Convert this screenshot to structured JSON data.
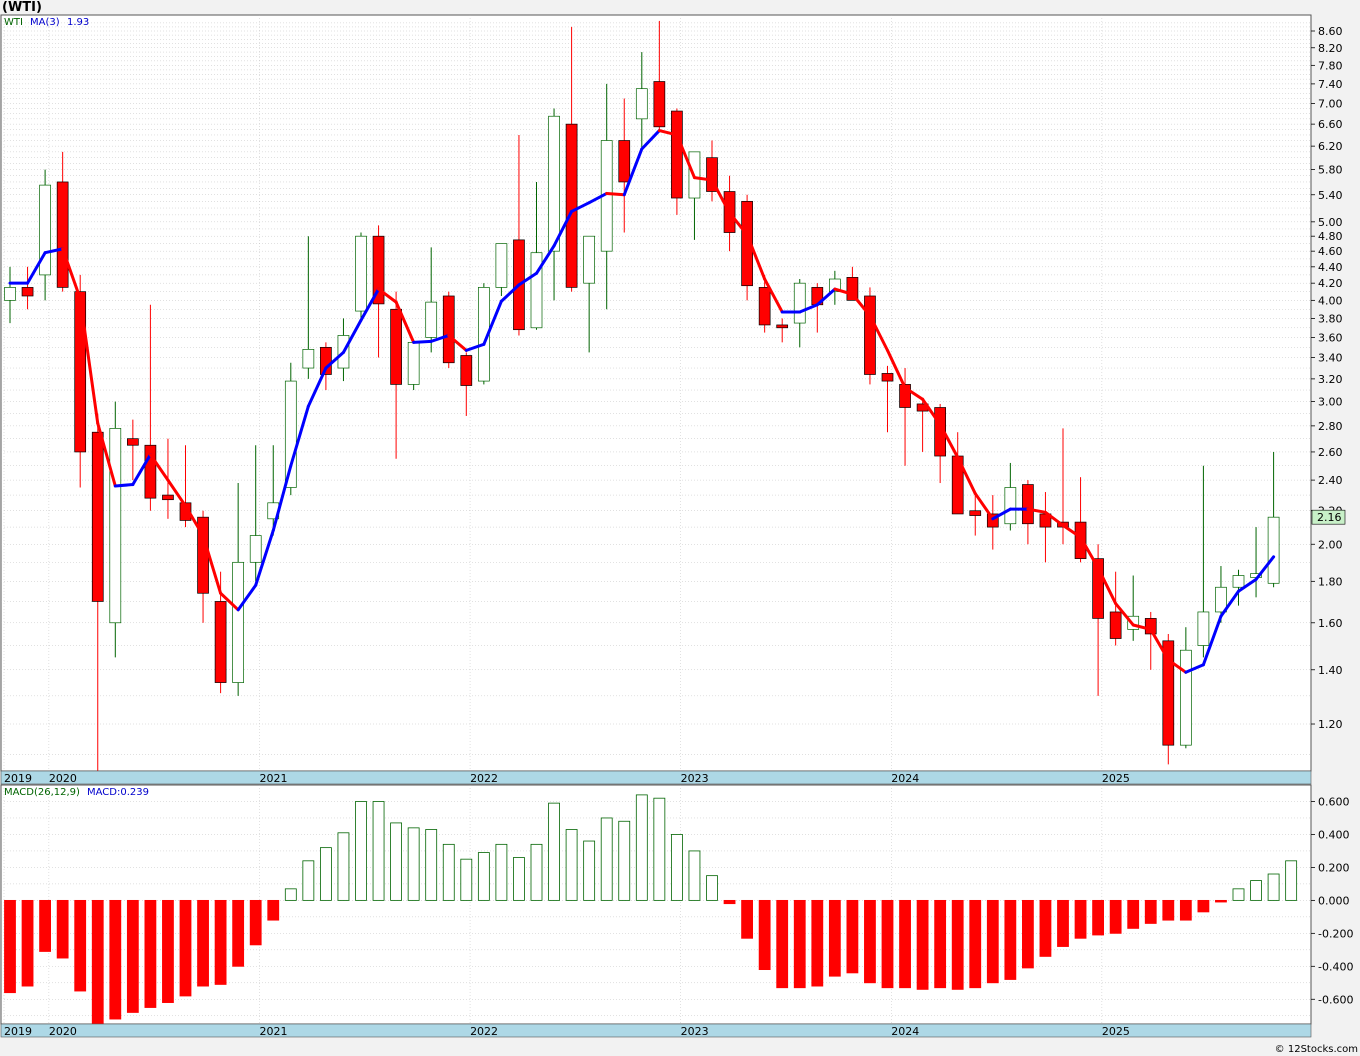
{
  "header": {
    "title": "(WTI)"
  },
  "legend": {
    "price_symbol": "WTI",
    "ma_label": "MA(3)",
    "ma_value": "1.93",
    "macd_label": "MACD(26,12,9)",
    "macd_value": "MACD:0.239"
  },
  "last_price_tag": "2.16",
  "footer": {
    "credit": "© 12Stocks.com"
  },
  "colors": {
    "up": "#006400",
    "down": "#ff0000",
    "ma_up": "#0000ff",
    "ma_down": "#ff0000",
    "axis_band": "#add8e6",
    "grid": "#b4b4b4",
    "tag_bg": "#c8f0c8"
  },
  "chart_data": [
    {
      "type": "candlestick",
      "frequency": "monthly",
      "title": "(WTI)",
      "series_label": "WTI",
      "scale": "log",
      "ylim": [
        1.05,
        9.0
      ],
      "y_ticks": [
        1.2,
        1.4,
        1.6,
        1.8,
        2.0,
        2.2,
        2.4,
        2.6,
        2.8,
        3.0,
        3.2,
        3.4,
        3.6,
        3.8,
        4.0,
        4.2,
        4.4,
        4.6,
        4.8,
        5.0,
        5.4,
        5.8,
        6.2,
        6.6,
        7.0,
        7.4,
        7.8,
        8.2,
        8.6
      ],
      "x_labels": [
        "2019",
        "2020",
        "2021",
        "2022",
        "2023",
        "2024",
        "2025"
      ],
      "year_starts": [
        [
          "2019",
          0
        ],
        [
          "2020",
          3
        ],
        [
          "2021",
          15
        ],
        [
          "2022",
          27
        ],
        [
          "2023",
          39
        ],
        [
          "2024",
          51
        ],
        [
          "2025",
          63
        ]
      ],
      "last_price": 2.16,
      "candles": [
        [
          4.0,
          4.4,
          3.75,
          4.15
        ],
        [
          4.15,
          4.4,
          3.9,
          4.05
        ],
        [
          4.3,
          5.8,
          4.0,
          5.55
        ],
        [
          5.6,
          6.1,
          4.1,
          4.15
        ],
        [
          4.1,
          4.3,
          2.35,
          2.6
        ],
        [
          2.75,
          2.9,
          1.05,
          1.7
        ],
        [
          1.6,
          3.0,
          1.45,
          2.78
        ],
        [
          2.7,
          2.85,
          2.4,
          2.65
        ],
        [
          2.65,
          3.95,
          2.2,
          2.28
        ],
        [
          2.3,
          2.7,
          2.15,
          2.27
        ],
        [
          2.25,
          2.65,
          2.1,
          2.14
        ],
        [
          2.16,
          2.2,
          1.6,
          1.74
        ],
        [
          1.7,
          1.85,
          1.31,
          1.35
        ],
        [
          1.35,
          2.38,
          1.3,
          1.9
        ],
        [
          1.9,
          2.65,
          1.8,
          2.05
        ],
        [
          2.15,
          2.65,
          2.05,
          2.25
        ],
        [
          2.35,
          3.35,
          2.3,
          3.18
        ],
        [
          3.3,
          4.8,
          3.2,
          3.48
        ],
        [
          3.5,
          3.55,
          3.1,
          3.24
        ],
        [
          3.3,
          3.8,
          3.18,
          3.62
        ],
        [
          3.88,
          4.85,
          3.8,
          4.8
        ],
        [
          4.8,
          4.95,
          3.4,
          3.96
        ],
        [
          3.9,
          4.1,
          2.55,
          3.15
        ],
        [
          3.15,
          3.55,
          3.1,
          3.55
        ],
        [
          3.6,
          4.65,
          3.45,
          3.98
        ],
        [
          4.05,
          4.1,
          3.3,
          3.35
        ],
        [
          3.42,
          3.45,
          2.88,
          3.14
        ],
        [
          3.18,
          4.2,
          3.15,
          4.15
        ],
        [
          4.15,
          4.7,
          4.05,
          4.7
        ],
        [
          4.75,
          6.4,
          3.62,
          3.68
        ],
        [
          3.7,
          5.6,
          3.68,
          4.58
        ],
        [
          4.6,
          6.9,
          4.0,
          6.75
        ],
        [
          6.6,
          8.7,
          4.1,
          4.15
        ],
        [
          4.2,
          4.75,
          3.45,
          4.8
        ],
        [
          4.6,
          7.4,
          3.9,
          6.3
        ],
        [
          6.3,
          7.1,
          4.85,
          5.6
        ],
        [
          6.7,
          8.1,
          6.1,
          7.3
        ],
        [
          7.45,
          8.85,
          6.45,
          6.55
        ],
        [
          6.85,
          6.9,
          5.1,
          5.35
        ],
        [
          5.35,
          6.1,
          4.75,
          6.1
        ],
        [
          6.0,
          6.3,
          5.3,
          5.45
        ],
        [
          5.45,
          5.7,
          4.6,
          4.85
        ],
        [
          5.3,
          5.4,
          4.0,
          4.17
        ],
        [
          4.15,
          4.3,
          3.65,
          3.73
        ],
        [
          3.73,
          3.8,
          3.55,
          3.7
        ],
        [
          3.75,
          4.25,
          3.5,
          4.2
        ],
        [
          4.15,
          4.2,
          3.65,
          3.95
        ],
        [
          4.1,
          4.35,
          3.95,
          4.25
        ],
        [
          4.27,
          4.4,
          4.0,
          4.0
        ],
        [
          4.05,
          4.15,
          3.15,
          3.24
        ],
        [
          3.25,
          3.32,
          2.75,
          3.18
        ],
        [
          3.15,
          3.3,
          2.5,
          2.95
        ],
        [
          2.98,
          3.0,
          2.6,
          2.92
        ],
        [
          2.95,
          2.98,
          2.38,
          2.57
        ],
        [
          2.57,
          2.75,
          2.18,
          2.18
        ],
        [
          2.2,
          2.3,
          2.05,
          2.17
        ],
        [
          2.18,
          2.3,
          1.97,
          2.1
        ],
        [
          2.12,
          2.52,
          2.08,
          2.35
        ],
        [
          2.37,
          2.4,
          2.0,
          2.12
        ],
        [
          2.18,
          2.32,
          1.9,
          2.1
        ],
        [
          2.13,
          2.78,
          2.0,
          2.1
        ],
        [
          2.13,
          2.42,
          1.9,
          1.92
        ],
        [
          1.92,
          2.0,
          1.3,
          1.62
        ],
        [
          1.65,
          1.85,
          1.5,
          1.53
        ],
        [
          1.57,
          1.83,
          1.52,
          1.63
        ],
        [
          1.62,
          1.65,
          1.4,
          1.55
        ],
        [
          1.52,
          1.55,
          1.07,
          1.13
        ],
        [
          1.13,
          1.58,
          1.12,
          1.48
        ],
        [
          1.5,
          2.5,
          1.45,
          1.65
        ],
        [
          1.65,
          1.88,
          1.6,
          1.77
        ],
        [
          1.77,
          1.86,
          1.68,
          1.83
        ],
        [
          1.82,
          2.1,
          1.72,
          1.84
        ],
        [
          1.79,
          2.6,
          1.77,
          2.16
        ]
      ],
      "ma3": [
        4.2,
        4.2,
        4.58,
        4.63,
        4.02,
        2.82,
        2.36,
        2.37,
        2.58,
        2.4,
        2.23,
        2.05,
        1.74,
        1.66,
        1.78,
        2.08,
        2.5,
        2.96,
        3.3,
        3.45,
        3.78,
        4.13,
        3.98,
        3.55,
        3.56,
        3.62,
        3.47,
        3.53,
        3.99,
        4.18,
        4.32,
        4.67,
        5.15,
        5.28,
        5.42,
        5.4,
        6.15,
        6.48,
        6.4,
        5.67,
        5.63,
        5.13,
        4.82,
        4.25,
        3.87,
        3.87,
        3.95,
        4.13,
        4.07,
        3.83,
        3.47,
        3.12,
        3.02,
        2.81,
        2.56,
        2.31,
        2.15,
        2.21,
        2.21,
        2.19,
        2.11,
        2.04,
        1.87,
        1.69,
        1.59,
        1.57,
        1.44,
        1.39,
        1.42,
        1.63,
        1.75,
        1.81,
        1.93
      ]
    },
    {
      "type": "bar",
      "title": "MACD(26,12,9)",
      "series_label": "MACD",
      "latest": 0.239,
      "ylim": [
        -0.75,
        0.7
      ],
      "y_ticks": [
        -0.6,
        -0.4,
        -0.2,
        0.0,
        0.2,
        0.4,
        0.6
      ],
      "y_tick_labels": [
        "-0.600",
        "-0.400",
        "-0.200",
        "0.000",
        "0.200",
        "0.400",
        "0.600"
      ],
      "x_labels": [
        "2019",
        "2020",
        "2021",
        "2022",
        "2023",
        "2024",
        "2025"
      ],
      "values": [
        -0.56,
        -0.52,
        -0.31,
        -0.35,
        -0.55,
        -0.76,
        -0.72,
        -0.68,
        -0.65,
        -0.62,
        -0.58,
        -0.52,
        -0.51,
        -0.4,
        -0.27,
        -0.12,
        0.07,
        0.24,
        0.32,
        0.41,
        0.6,
        0.6,
        0.47,
        0.44,
        0.43,
        0.34,
        0.25,
        0.29,
        0.34,
        0.26,
        0.34,
        0.59,
        0.43,
        0.36,
        0.5,
        0.48,
        0.64,
        0.62,
        0.4,
        0.3,
        0.15,
        -0.02,
        -0.23,
        -0.42,
        -0.53,
        -0.53,
        -0.52,
        -0.46,
        -0.44,
        -0.5,
        -0.53,
        -0.53,
        -0.54,
        -0.53,
        -0.54,
        -0.53,
        -0.5,
        -0.48,
        -0.41,
        -0.34,
        -0.28,
        -0.23,
        -0.21,
        -0.2,
        -0.17,
        -0.14,
        -0.12,
        -0.12,
        -0.07,
        -0.01,
        0.07,
        0.12,
        0.16,
        0.24
      ]
    }
  ]
}
